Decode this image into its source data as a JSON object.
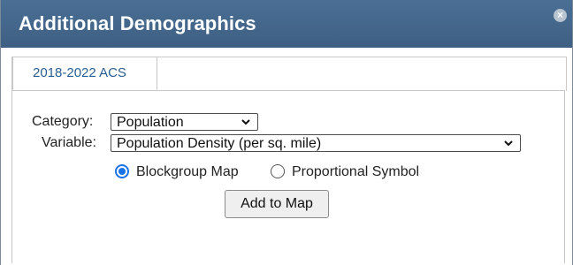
{
  "dialog": {
    "title": "Additional Demographics",
    "close_icon": "close-icon"
  },
  "tabs": [
    {
      "label": "2018-2022 ACS",
      "active": true
    }
  ],
  "form": {
    "category_label": "Category:",
    "category_value": "Population",
    "variable_label": "Variable:",
    "variable_value": "Population Density (per sq. mile)",
    "map_type_options": [
      {
        "label": "Blockgroup Map",
        "checked": true
      },
      {
        "label": "Proportional Symbol",
        "checked": false
      }
    ],
    "add_button_label": "Add to Map"
  },
  "colors": {
    "titlebar": "#456a8f",
    "tab_text": "#2a5d8f",
    "radio_checked": "#1a73e8"
  }
}
